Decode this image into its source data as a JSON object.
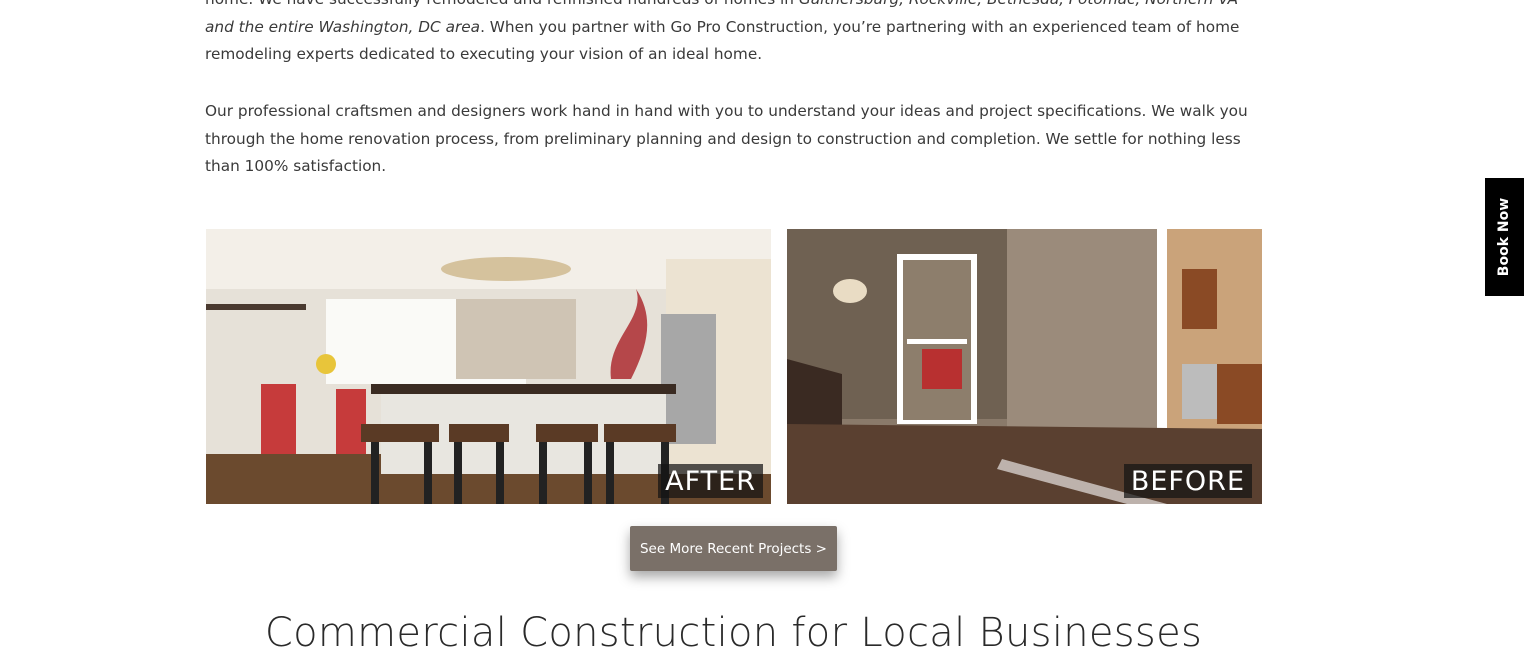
{
  "intro": {
    "p1_a": "home. We have successfully remodeled and refinished hundreds of homes in ",
    "p1_locations_1": "Gaithersburg, Rockville, Bethesda, Potomac, Northern VA and the entire Washington, DC area",
    "p1_b": ". When you partner with Go Pro Construction, you’re partnering with an experienced team of home remodeling experts dedicated to executing your vision of an ideal home.",
    "p2": "Our professional craftsmen and designers work hand in hand with you to understand your ideas and project specifications. We walk you through the home renovation process, from preliminary planning and design to construction and completion. We settle for nothing less than 100% satisfaction."
  },
  "gallery": {
    "after_label": "AFTER",
    "before_label": "BEFORE"
  },
  "cta": {
    "label": "See More Recent Projects >"
  },
  "section": {
    "heading": "Commercial Construction for Local Businesses"
  },
  "sidebar_tab": {
    "label": "Book Now"
  },
  "colors": {
    "button_bg": "#7a7068",
    "tab_bg": "#000000"
  }
}
